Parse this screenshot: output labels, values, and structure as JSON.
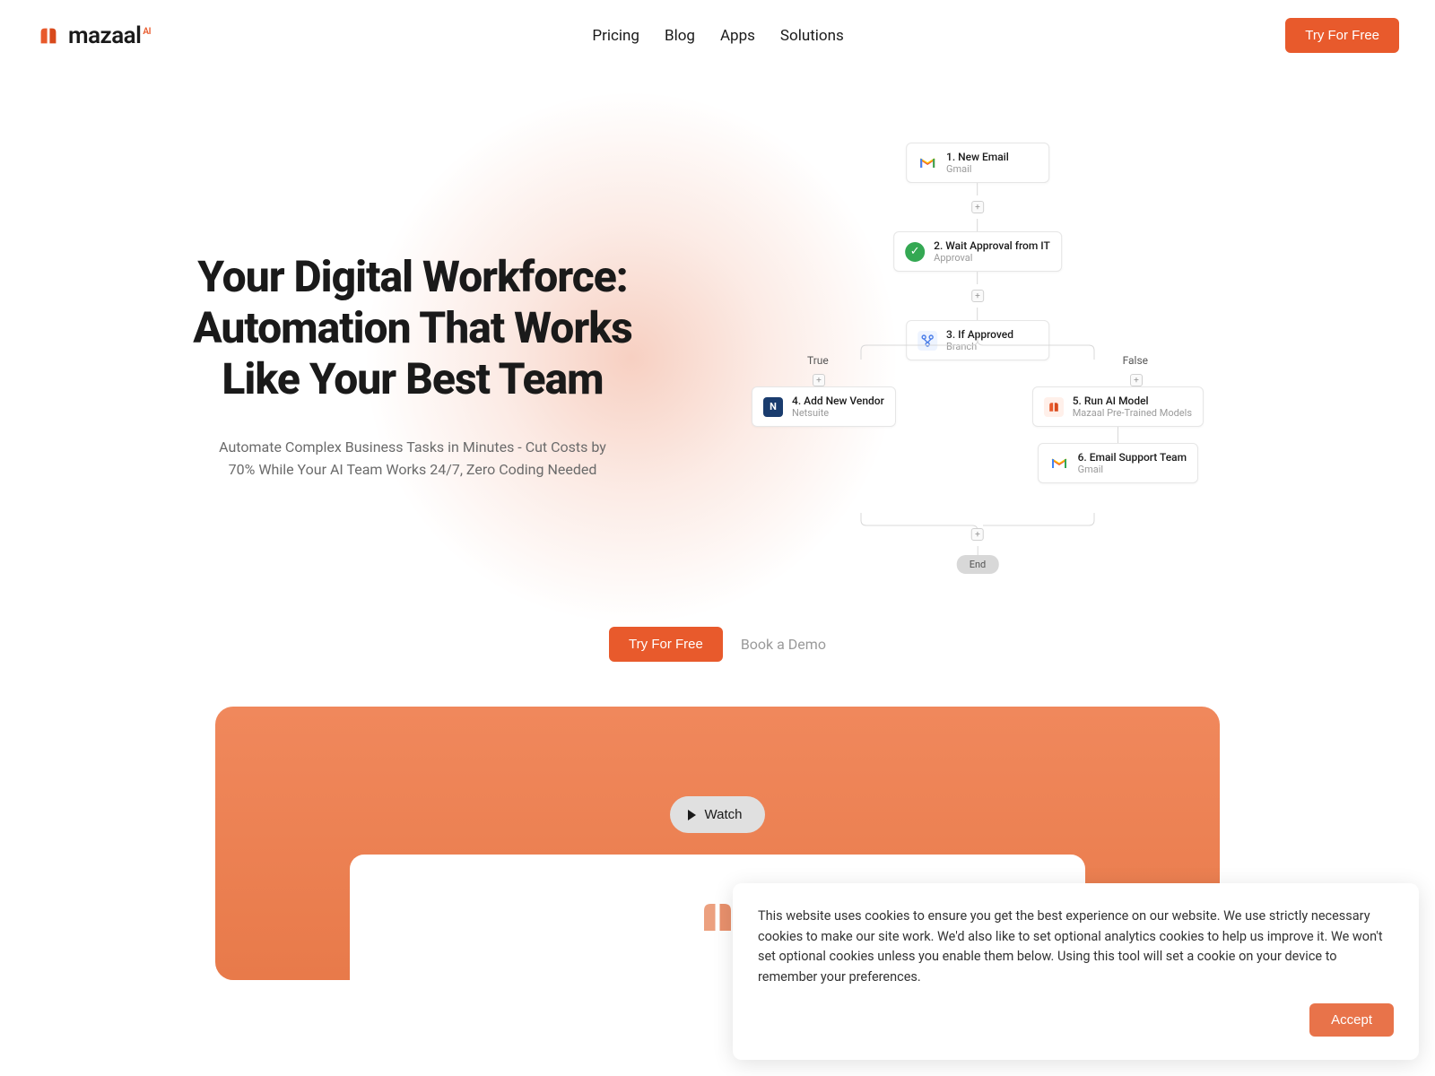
{
  "header": {
    "brand": "mazaal",
    "brand_suffix": "AI",
    "nav": [
      "Pricing",
      "Blog",
      "Apps",
      "Solutions"
    ],
    "cta": "Try For Free"
  },
  "hero": {
    "title": "Your Digital Workforce: Automation That Works Like Your Best Team",
    "subtitle": "Automate Complex Business Tasks in Minutes - Cut Costs by 70% While Your AI Team Works 24/7, Zero Coding Needed"
  },
  "flow": {
    "nodes": [
      {
        "title": "1. New Email",
        "sub": "Gmail",
        "icon": "gmail"
      },
      {
        "title": "2. Wait Approval from IT",
        "sub": "Approval",
        "icon": "check"
      },
      {
        "title": "3. If Approved",
        "sub": "Branch",
        "icon": "branch"
      }
    ],
    "branch_labels": {
      "left": "True",
      "right": "False"
    },
    "left_branch": [
      {
        "title": "4. Add New Vendor",
        "sub": "Netsuite",
        "icon": "netsuite"
      }
    ],
    "right_branch": [
      {
        "title": "5. Run AI Model",
        "sub": "Mazaal Pre-Trained Models",
        "icon": "mazaal"
      },
      {
        "title": "6. Email Support Team",
        "sub": "Gmail",
        "icon": "gmail"
      }
    ],
    "end": "End"
  },
  "cta": {
    "primary": "Try For Free",
    "secondary": "Book a Demo"
  },
  "video": {
    "watch": "Watch"
  },
  "cookie": {
    "text": "This website uses cookies to ensure you get the best experience on our website. We use strictly necessary cookies to make our site work. We'd also like to set optional analytics cookies to help us improve it. We won't set optional cookies unless you enable them below. Using this tool will set a cookie on your device to remember your preferences.",
    "accept": "Accept"
  }
}
